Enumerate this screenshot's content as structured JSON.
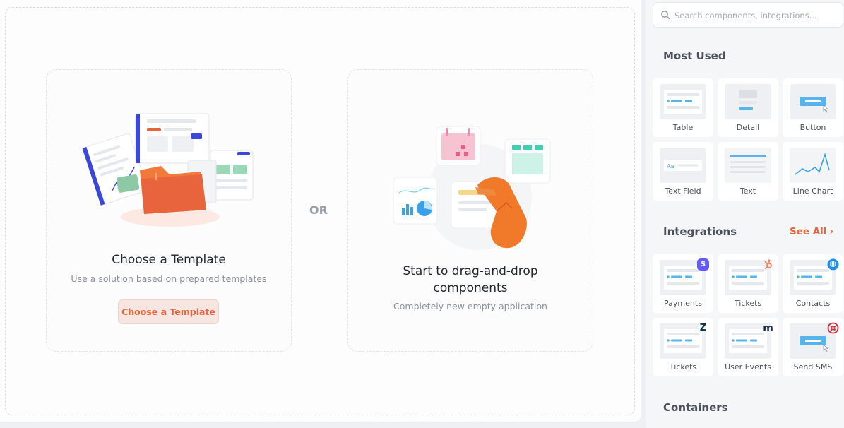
{
  "canvas": {
    "template_card": {
      "title": "Choose a Template",
      "subtitle": "Use a solution based on prepared templates",
      "button_label": "Choose a Template"
    },
    "or_label": "OR",
    "dnd_card": {
      "title": "Start to drag-and-drop components",
      "subtitle": "Completely new empty application"
    }
  },
  "sidebar": {
    "search": {
      "placeholder": "Search components, integrations..."
    },
    "most_used": {
      "title": "Most Used",
      "items": [
        {
          "label": "Table",
          "icon": "table-icon"
        },
        {
          "label": "Detail",
          "icon": "detail-icon"
        },
        {
          "label": "Button",
          "icon": "button-icon"
        },
        {
          "label": "Text Field",
          "icon": "text-field-icon",
          "thumb_text": "Aa"
        },
        {
          "label": "Text",
          "icon": "text-icon"
        },
        {
          "label": "Line Chart",
          "icon": "line-chart-icon"
        }
      ]
    },
    "integrations": {
      "title": "Integrations",
      "see_all": "See All",
      "items": [
        {
          "label": "Payments",
          "badge": "stripe-icon",
          "badge_text": "S"
        },
        {
          "label": "Tickets",
          "badge": "hubspot-icon"
        },
        {
          "label": "Contacts",
          "badge": "intercom-icon"
        },
        {
          "label": "Tickets",
          "badge": "zendesk-icon",
          "badge_text": "Z"
        },
        {
          "label": "User Events",
          "badge": "mixpanel-icon",
          "badge_text": "m"
        },
        {
          "label": "Send SMS",
          "badge": "twilio-icon"
        }
      ]
    },
    "containers": {
      "title": "Containers"
    }
  },
  "colors": {
    "accent": "#e8643c",
    "accent_bg": "#f6e5e1",
    "thumb_blue": "#5ab4ec",
    "stripe": "#635bff",
    "hubspot": "#ff7a59",
    "intercom": "#1f8ded",
    "zendesk": "#03363d",
    "twilio": "#e22133"
  }
}
